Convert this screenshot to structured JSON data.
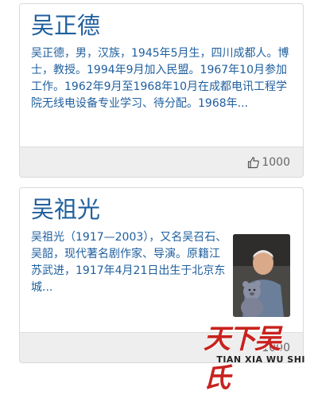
{
  "cards": [
    {
      "title": "吴正德",
      "description": "吴正德，男，汉族，1945年5月生，四川成都人。博士，教授。1994年9月加入民盟。1967年10月参加工作。1962年9月至1968年10月在成都电讯工程学院无线电设备专业学习、待分配。1968年...",
      "likes": "1000"
    },
    {
      "title": "吴祖光",
      "description": "吴祖光（1917—2003），又名吴召石、吴韶，现代著名剧作家、导演。原籍江苏武进，1917年4月21日出生于北京东城...",
      "likes": "1000",
      "has_photo": true
    }
  ],
  "watermark": {
    "chinese": "天下吴氏",
    "pinyin": "TIAN XIA WU SHI"
  },
  "colors": {
    "title": "#1f5f9e",
    "footer_bg": "#eeeeee",
    "watermark_red": "#c8221e"
  },
  "icons": {
    "like": "thumbs-up-icon"
  }
}
